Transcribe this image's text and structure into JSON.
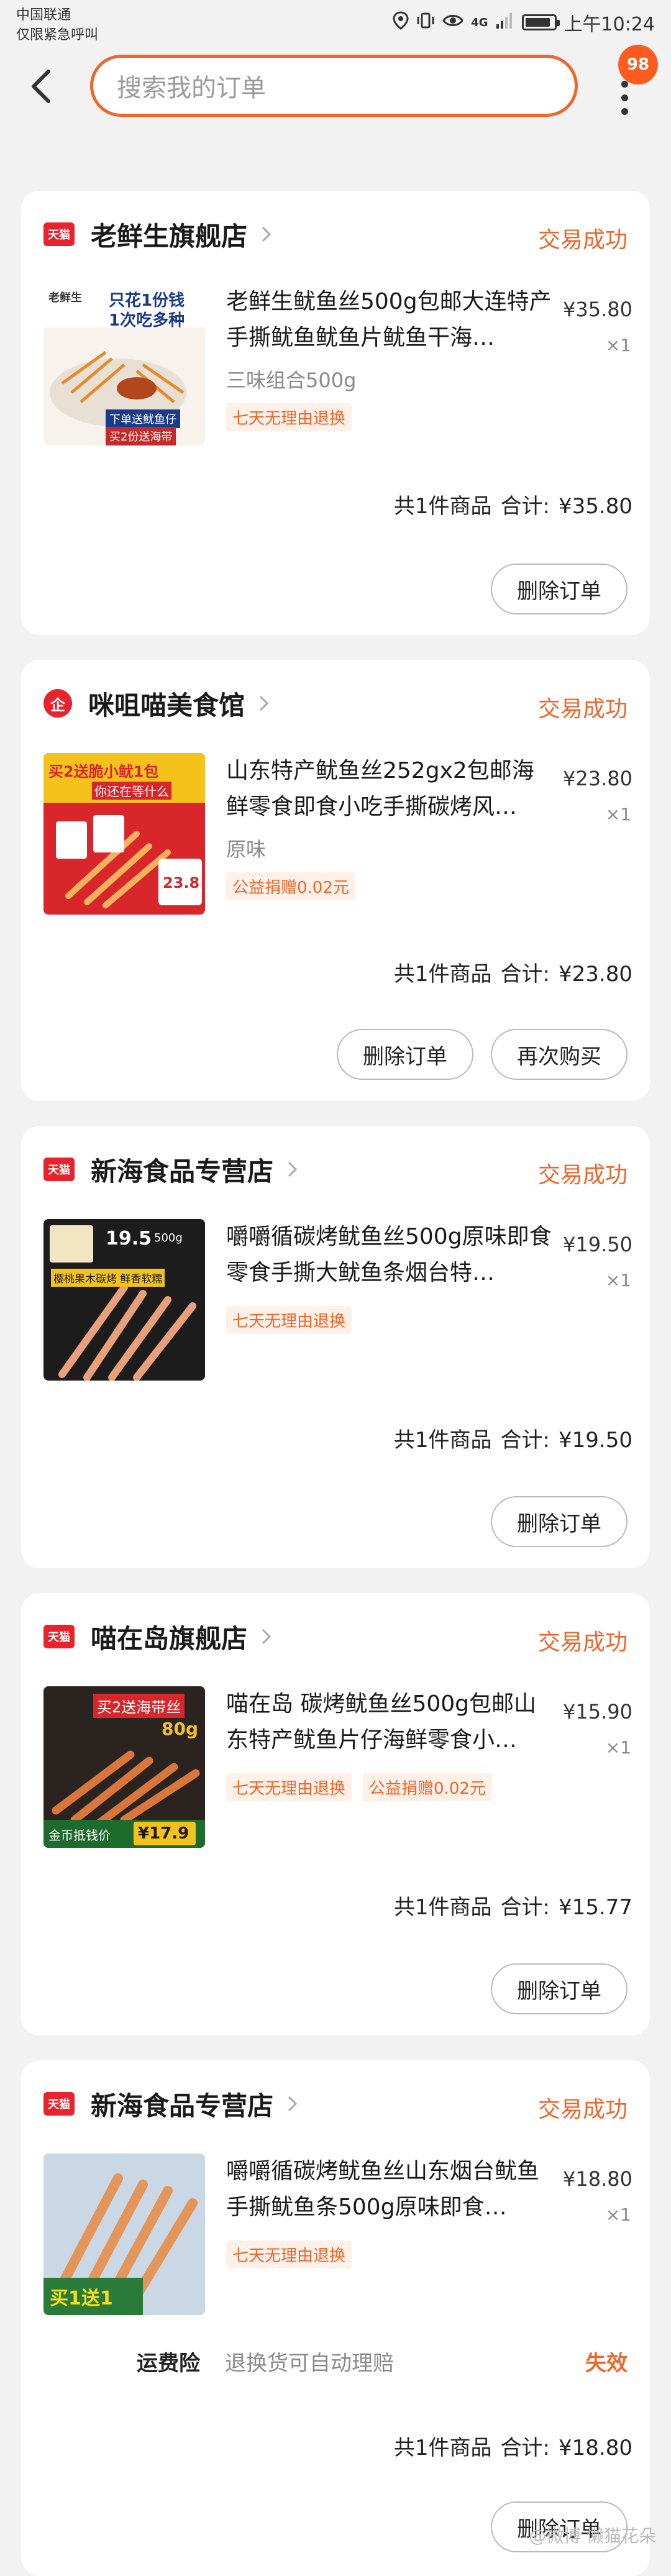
{
  "status_bar": {
    "carrier_line1": "中国联通",
    "carrier_line2": "仅限紧急呼叫",
    "network": "4G",
    "time": "上午10:24"
  },
  "header": {
    "search_placeholder": "搜索我的订单",
    "badge_count": "98"
  },
  "orders": [
    {
      "store_badge": "天猫",
      "store_name": "老鲜生旗舰店",
      "status": "交易成功",
      "title": "老鲜生鱿鱼丝500g包邮大连特产手撕鱿鱼鱿鱼片鱿鱼干海…",
      "sku": "三味组合500g",
      "tags": [
        "七天无理由退换"
      ],
      "price": "¥35.80",
      "qty": "×1",
      "count_text": "共1件商品",
      "total_label": "合计:",
      "total": "¥35.80",
      "buttons": [
        "删除订单"
      ],
      "thumb_text": [
        "老鲜生",
        "只花1份钱",
        "1次吃多种",
        "下单送鱿鱼仔",
        "买2份送海带"
      ]
    },
    {
      "store_badge": "企",
      "store_name": "咪咀喵美食馆",
      "status": "交易成功",
      "title": "山东特产鱿鱼丝252gx2包邮海鲜零食即食小吃手撕碳烤风…",
      "sku": "原味",
      "tags": [
        "公益捐赠0.02元"
      ],
      "price": "¥23.80",
      "qty": "×1",
      "count_text": "共1件商品",
      "total_label": "合计:",
      "total": "¥23.80",
      "buttons": [
        "删除订单",
        "再次购买"
      ],
      "thumb_text": [
        "买2送脆小鱿1包",
        "你还在等什么",
        "23.8"
      ]
    },
    {
      "store_badge": "天猫",
      "store_name": "新海食品专营店",
      "status": "交易成功",
      "title": "嚼嚼循碳烤鱿鱼丝500g原味即食零食手撕大鱿鱼条烟台特…",
      "sku": "",
      "tags": [
        "七天无理由退换"
      ],
      "price": "¥19.50",
      "qty": "×1",
      "count_text": "共1件商品",
      "total_label": "合计:",
      "total": "¥19.50",
      "buttons": [
        "删除订单"
      ],
      "thumb_text": [
        "19.5",
        "500g",
        "樱桃果木碳烤 鲜香软糯"
      ]
    },
    {
      "store_badge": "天猫",
      "store_name": "喵在岛旗舰店",
      "status": "交易成功",
      "title": "喵在岛 碳烤鱿鱼丝500g包邮山东特产鱿鱼片仔海鲜零食小…",
      "sku": "",
      "tags": [
        "七天无理由退换",
        "公益捐赠0.02元"
      ],
      "price": "¥15.90",
      "qty": "×1",
      "count_text": "共1件商品",
      "total_label": "合计:",
      "total": "¥15.77",
      "buttons": [
        "删除订单"
      ],
      "thumb_text": [
        "买2送海带丝",
        "80g",
        "金币抵钱价",
        "¥17.9"
      ]
    },
    {
      "store_badge": "天猫",
      "store_name": "新海食品专营店",
      "status": "交易成功",
      "title": "嚼嚼循碳烤鱿鱼丝山东烟台鱿鱼手撕鱿鱼条500g原味即食…",
      "sku": "",
      "tags": [
        "七天无理由退换"
      ],
      "price": "¥18.80",
      "qty": "×1",
      "insurance": {
        "label": "运费险",
        "desc": "退换货可自动理赔",
        "status": "失效"
      },
      "count_text": "共1件商品",
      "total_label": "合计:",
      "total": "¥18.80",
      "buttons": [
        "删除订单"
      ],
      "thumb_text": [
        "买1送1"
      ]
    }
  ],
  "watermark": "@微博 懒猫花朵"
}
